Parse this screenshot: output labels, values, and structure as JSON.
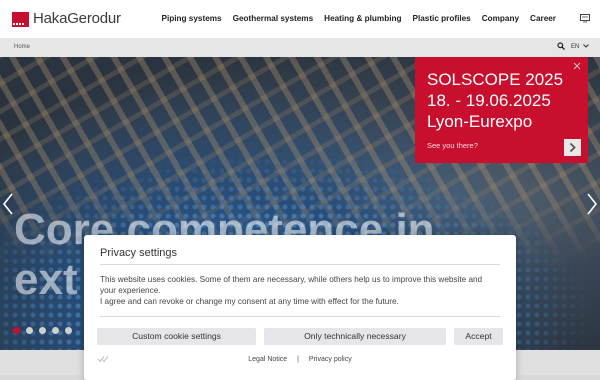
{
  "brand": {
    "name": "HakaGerodur"
  },
  "nav": {
    "items": [
      "Piping systems",
      "Geothermal systems",
      "Heating & plumbing",
      "Plastic profiles",
      "Company",
      "Career"
    ]
  },
  "breadcrumb": {
    "home": "Home"
  },
  "language": {
    "current": "EN"
  },
  "hero": {
    "headline_line1": "Core competence in",
    "headline_line2": "ext"
  },
  "event": {
    "line1": "SOLSCOPE 2025",
    "line2": "18. - 19.06.2025",
    "line3": "Lyon-Eurexpo",
    "link": "See you there?"
  },
  "privacy": {
    "title": "Privacy settings",
    "text_line1": "This website uses cookies. Some of them are necessary, while others help us to improve this website and your experience.",
    "text_line2": "I agree and can revoke or change my consent at any time with effect for the future.",
    "btn_custom": "Custom cookie settings",
    "btn_necessary": "Only technically necessary",
    "btn_accept": "Accept",
    "legal_notice": "Legal Notice",
    "separator": "|",
    "privacy_policy": "Privacy policy"
  },
  "colors": {
    "brand_red": "#c8102e"
  }
}
